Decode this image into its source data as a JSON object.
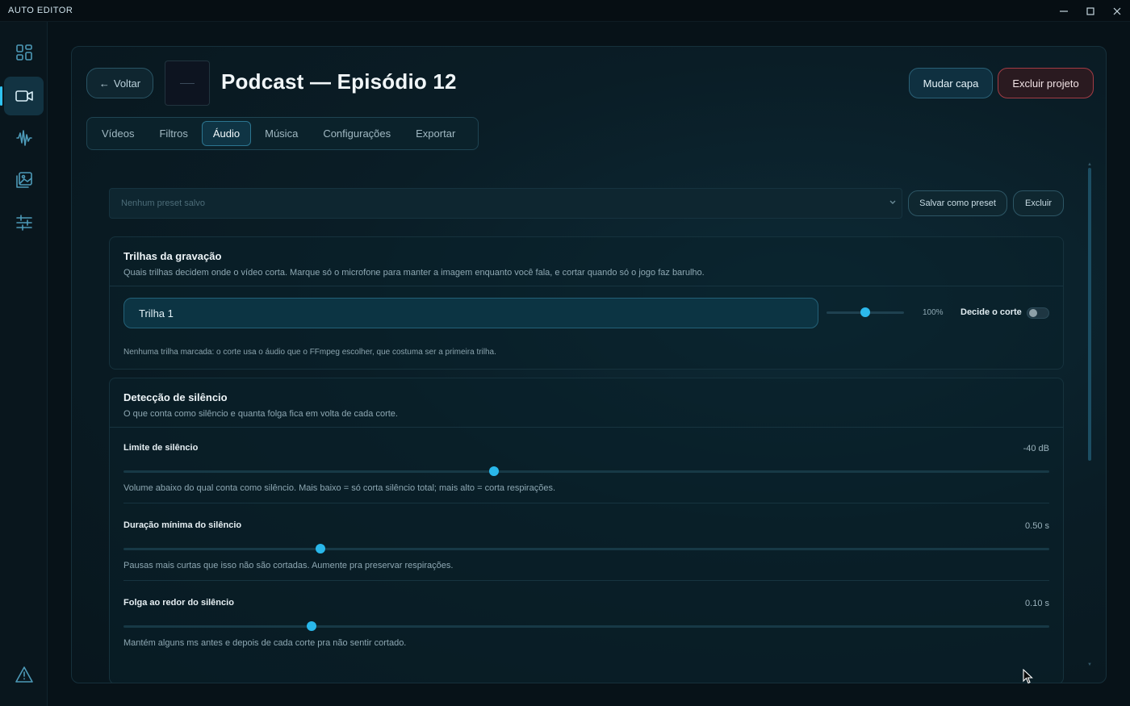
{
  "app": {
    "title": "AUTO EDITOR"
  },
  "window": {
    "minimize": "─",
    "maximize": "☐",
    "close": "✕"
  },
  "sidebar": {
    "items": [
      {
        "icon": "dashboard-icon",
        "active": false
      },
      {
        "icon": "video-camera-icon",
        "active": true
      },
      {
        "icon": "waveform-icon",
        "active": false
      },
      {
        "icon": "images-icon",
        "active": false
      },
      {
        "icon": "sliders-icon",
        "active": false
      }
    ],
    "bottom_icon": "alert-triangle-icon"
  },
  "header": {
    "back_label": "Voltar",
    "project_title": "Podcast — Episódio 12",
    "change_cover_label": "Mudar capa",
    "delete_project_label": "Excluir projeto"
  },
  "tabs": [
    {
      "label": "Vídeos",
      "active": false
    },
    {
      "label": "Filtros",
      "active": false
    },
    {
      "label": "Áudio",
      "active": true
    },
    {
      "label": "Música",
      "active": false
    },
    {
      "label": "Configurações",
      "active": false
    },
    {
      "label": "Exportar",
      "active": false
    }
  ],
  "preset": {
    "placeholder": "Nenhum preset salvo",
    "save_label": "Salvar como preset",
    "delete_label": "Excluir"
  },
  "tracks_card": {
    "title": "Trilhas da gravação",
    "description": "Quais trilhas decidem onde o vídeo corta. Marque só o microfone para manter a imagem enquanto você fala, e cortar quando só o jogo faz barulho.",
    "track": {
      "name": "Trilha 1",
      "volume_fraction": 0.5,
      "volume_label": "100%",
      "cut_label": "Decide o corte",
      "cut_enabled": false
    },
    "note": "Nenhuma trilha marcada: o corte usa o áudio que o FFmpeg escolher, que costuma ser a primeira trilha."
  },
  "silence_card": {
    "title": "Detecção de silêncio",
    "description": "O que conta como silêncio e quanta folga fica em volta de cada corte.",
    "params": [
      {
        "label": "Limite de silêncio",
        "value": "-40 dB",
        "fraction": 0.4,
        "description": "Volume abaixo do qual conta como silêncio. Mais baixo = só corta silêncio total; mais alto = corta respirações."
      },
      {
        "label": "Duração mínima do silêncio",
        "value": "0.50 s",
        "fraction": 0.213,
        "description": "Pausas mais curtas que isso não são cortadas. Aumente pra preservar respirações."
      },
      {
        "label": "Folga ao redor do silêncio",
        "value": "0.10 s",
        "fraction": 0.203,
        "description": "Mantém alguns ms antes e depois de cada corte pra não sentir cortado."
      }
    ]
  },
  "colors": {
    "accent": "#2cb9ec",
    "danger": "#a33c45",
    "background": "#071218"
  }
}
